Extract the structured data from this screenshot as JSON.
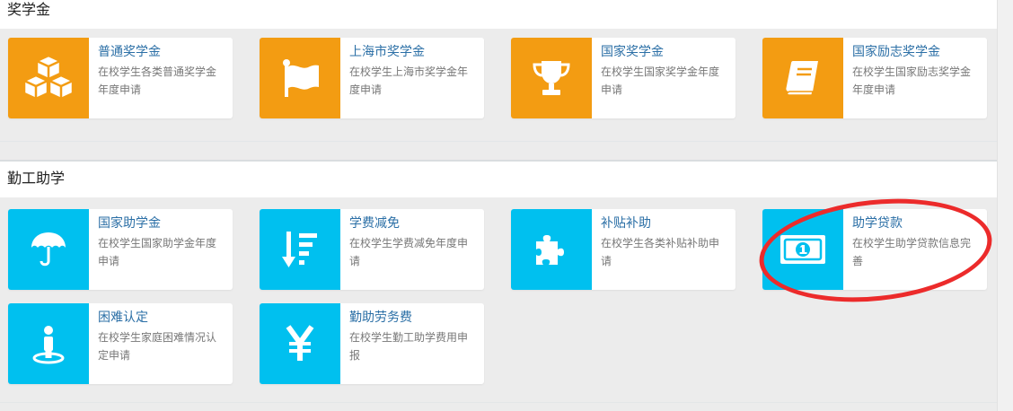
{
  "sections": [
    {
      "title": "奖学金",
      "cards": [
        {
          "title": "普通奖学金",
          "desc": "在校学生各类普通奖学金年度申请",
          "icon": "cubes-icon"
        },
        {
          "title": "上海市奖学金",
          "desc": "在校学生上海市奖学金年度申请",
          "icon": "flag-icon"
        },
        {
          "title": "国家奖学金",
          "desc": "在校学生国家奖学金年度申请",
          "icon": "trophy-icon"
        },
        {
          "title": "国家励志奖学金",
          "desc": "在校学生国家励志奖学金年度申请",
          "icon": "book-icon"
        }
      ]
    },
    {
      "title": "勤工助学",
      "cards": [
        {
          "title": "国家助学金",
          "desc": "在校学生国家助学金年度申请",
          "icon": "umbrella-icon"
        },
        {
          "title": "学费减免",
          "desc": "在校学生学费减免年度申请",
          "icon": "sort-amount-down-icon"
        },
        {
          "title": "补贴补助",
          "desc": "在校学生各类补贴补助申请",
          "icon": "puzzle-piece-icon"
        },
        {
          "title": "助学贷款",
          "desc": "在校学生助学贷款信息完善",
          "icon": "money-bill-icon"
        },
        {
          "title": "困难认定",
          "desc": "在校学生家庭困难情况认定申请",
          "icon": "person-pin-icon"
        },
        {
          "title": "勤助劳务费",
          "desc": "在校学生勤工助学费用申报",
          "icon": "yen-icon"
        }
      ]
    }
  ],
  "colors": {
    "scholarship_accent": "#f39c12",
    "work_study_accent": "#00c0ef",
    "title_link": "#2b6fa6",
    "annotation": "#ec2b2b"
  }
}
